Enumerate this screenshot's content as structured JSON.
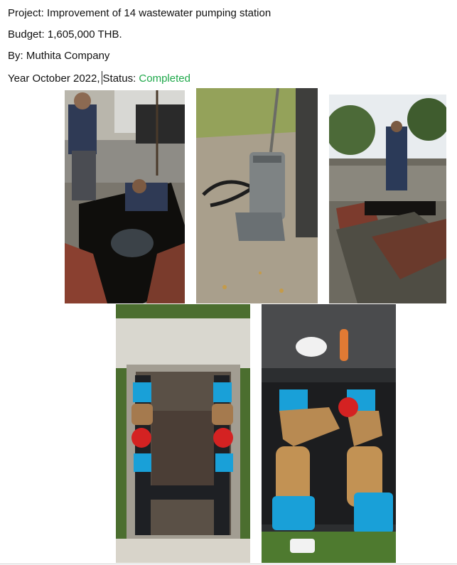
{
  "document": {
    "project_label": "Project:",
    "project_value": "Improvement of 14 wastewater pumping station",
    "budget_label": "Budget:",
    "budget_value": "1,605,000 THB.",
    "by_label": "By:",
    "by_value": "Muthita Company",
    "year_text": "Year October 2022,",
    "status_label": "Status:",
    "status_value": "Completed",
    "status_color": "#1ea84a"
  },
  "photos": [
    {
      "subject": "workers opening pump pit"
    },
    {
      "subject": "submersible pump on chain"
    },
    {
      "subject": "opened pit covers with workers"
    },
    {
      "subject": "valve pit with blue pipes"
    },
    {
      "subject": "brass valves with blue caps"
    }
  ]
}
